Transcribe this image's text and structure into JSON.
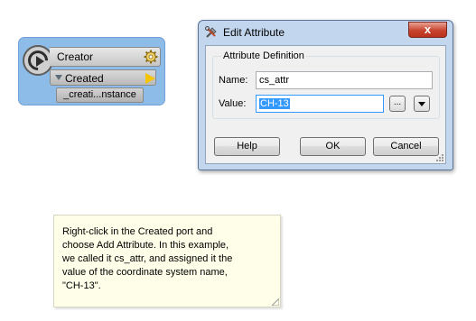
{
  "transformer": {
    "name": "Creator",
    "icon": "creator-icon",
    "settings_icon": "gear-icon",
    "output_port": "Created",
    "attribute": "_creati...nstance"
  },
  "dialog": {
    "title": "Edit Attribute",
    "close_label": "x",
    "group_label": "Attribute Definition",
    "name_label": "Name:",
    "name_value": "cs_attr",
    "value_label": "Value:",
    "value_value": "CH-13",
    "browse_label": "...",
    "buttons": {
      "help": "Help",
      "ok": "OK",
      "cancel": "Cancel"
    }
  },
  "note": {
    "text": "Right-click in the Created port and\nchoose Add Attribute. In this example,\nwe called it cs_attr, and assigned it the\nvalue of the coordinate system name,\n\"CH-13\"."
  },
  "colors": {
    "node_bg": "#8ebce9",
    "port_flag": "#f5c400",
    "dialog_frame": "#c2d7ee",
    "close_button": "#c8442f",
    "note_bg": "#ffffe9",
    "selection": "#3399ff"
  }
}
